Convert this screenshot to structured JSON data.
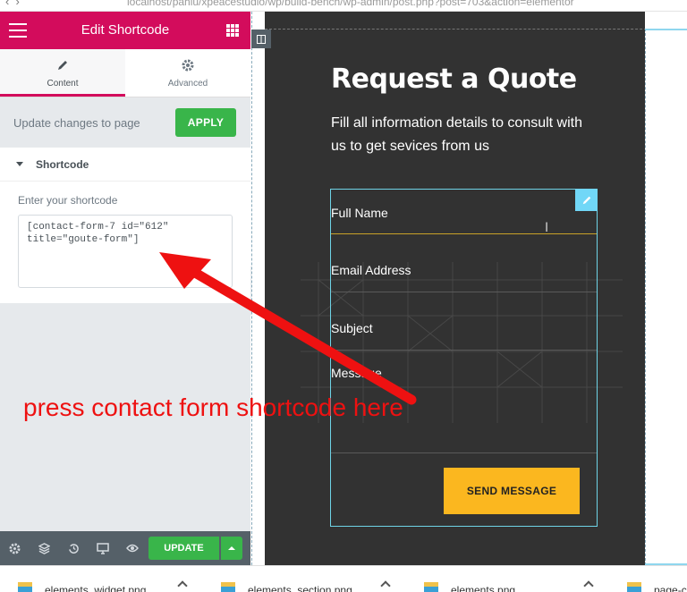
{
  "browser": {
    "url": "localhost/pahiu/xpeacestudio/wp/build-bench/wp-admin/post.php?post=703&action=elementor"
  },
  "panel": {
    "title": "Edit Shortcode",
    "tabs": [
      {
        "label": "Content",
        "icon": "pencil-icon"
      },
      {
        "label": "Advanced",
        "icon": "gear-icon"
      }
    ],
    "update_text": "Update changes to page",
    "apply_label": "APPLY",
    "section_label": "Shortcode",
    "shortcode_label": "Enter your shortcode",
    "shortcode_value": "[contact-form-7 id=\"612\" title=\"goute-form\"]",
    "footer": {
      "update_label": "UPDATE",
      "icons": [
        "settings-icon",
        "navigator-icon",
        "history-icon",
        "responsive-icon",
        "preview-eye-icon"
      ]
    },
    "colors": {
      "header": "#d30c5c",
      "apply": "#39b54a",
      "footer": "#556068"
    }
  },
  "preview": {
    "heading": "Request a Quote",
    "subheading": "Fill all information details to consult with us to get sevices from us",
    "fields": [
      "Full Name",
      "Email Address",
      "Subject",
      "Message"
    ],
    "send_label": "SEND MESSAGE",
    "colors": {
      "background": "#323232",
      "send": "#fbb71f",
      "active_line": "#c9a227"
    }
  },
  "annotation": {
    "text": "press contact form shortcode here",
    "color": "#ee1111"
  },
  "downloads": [
    {
      "name": "elements_widget.png"
    },
    {
      "name": "elements_section.png"
    },
    {
      "name": "elements.png"
    },
    {
      "name": "page-c"
    }
  ]
}
